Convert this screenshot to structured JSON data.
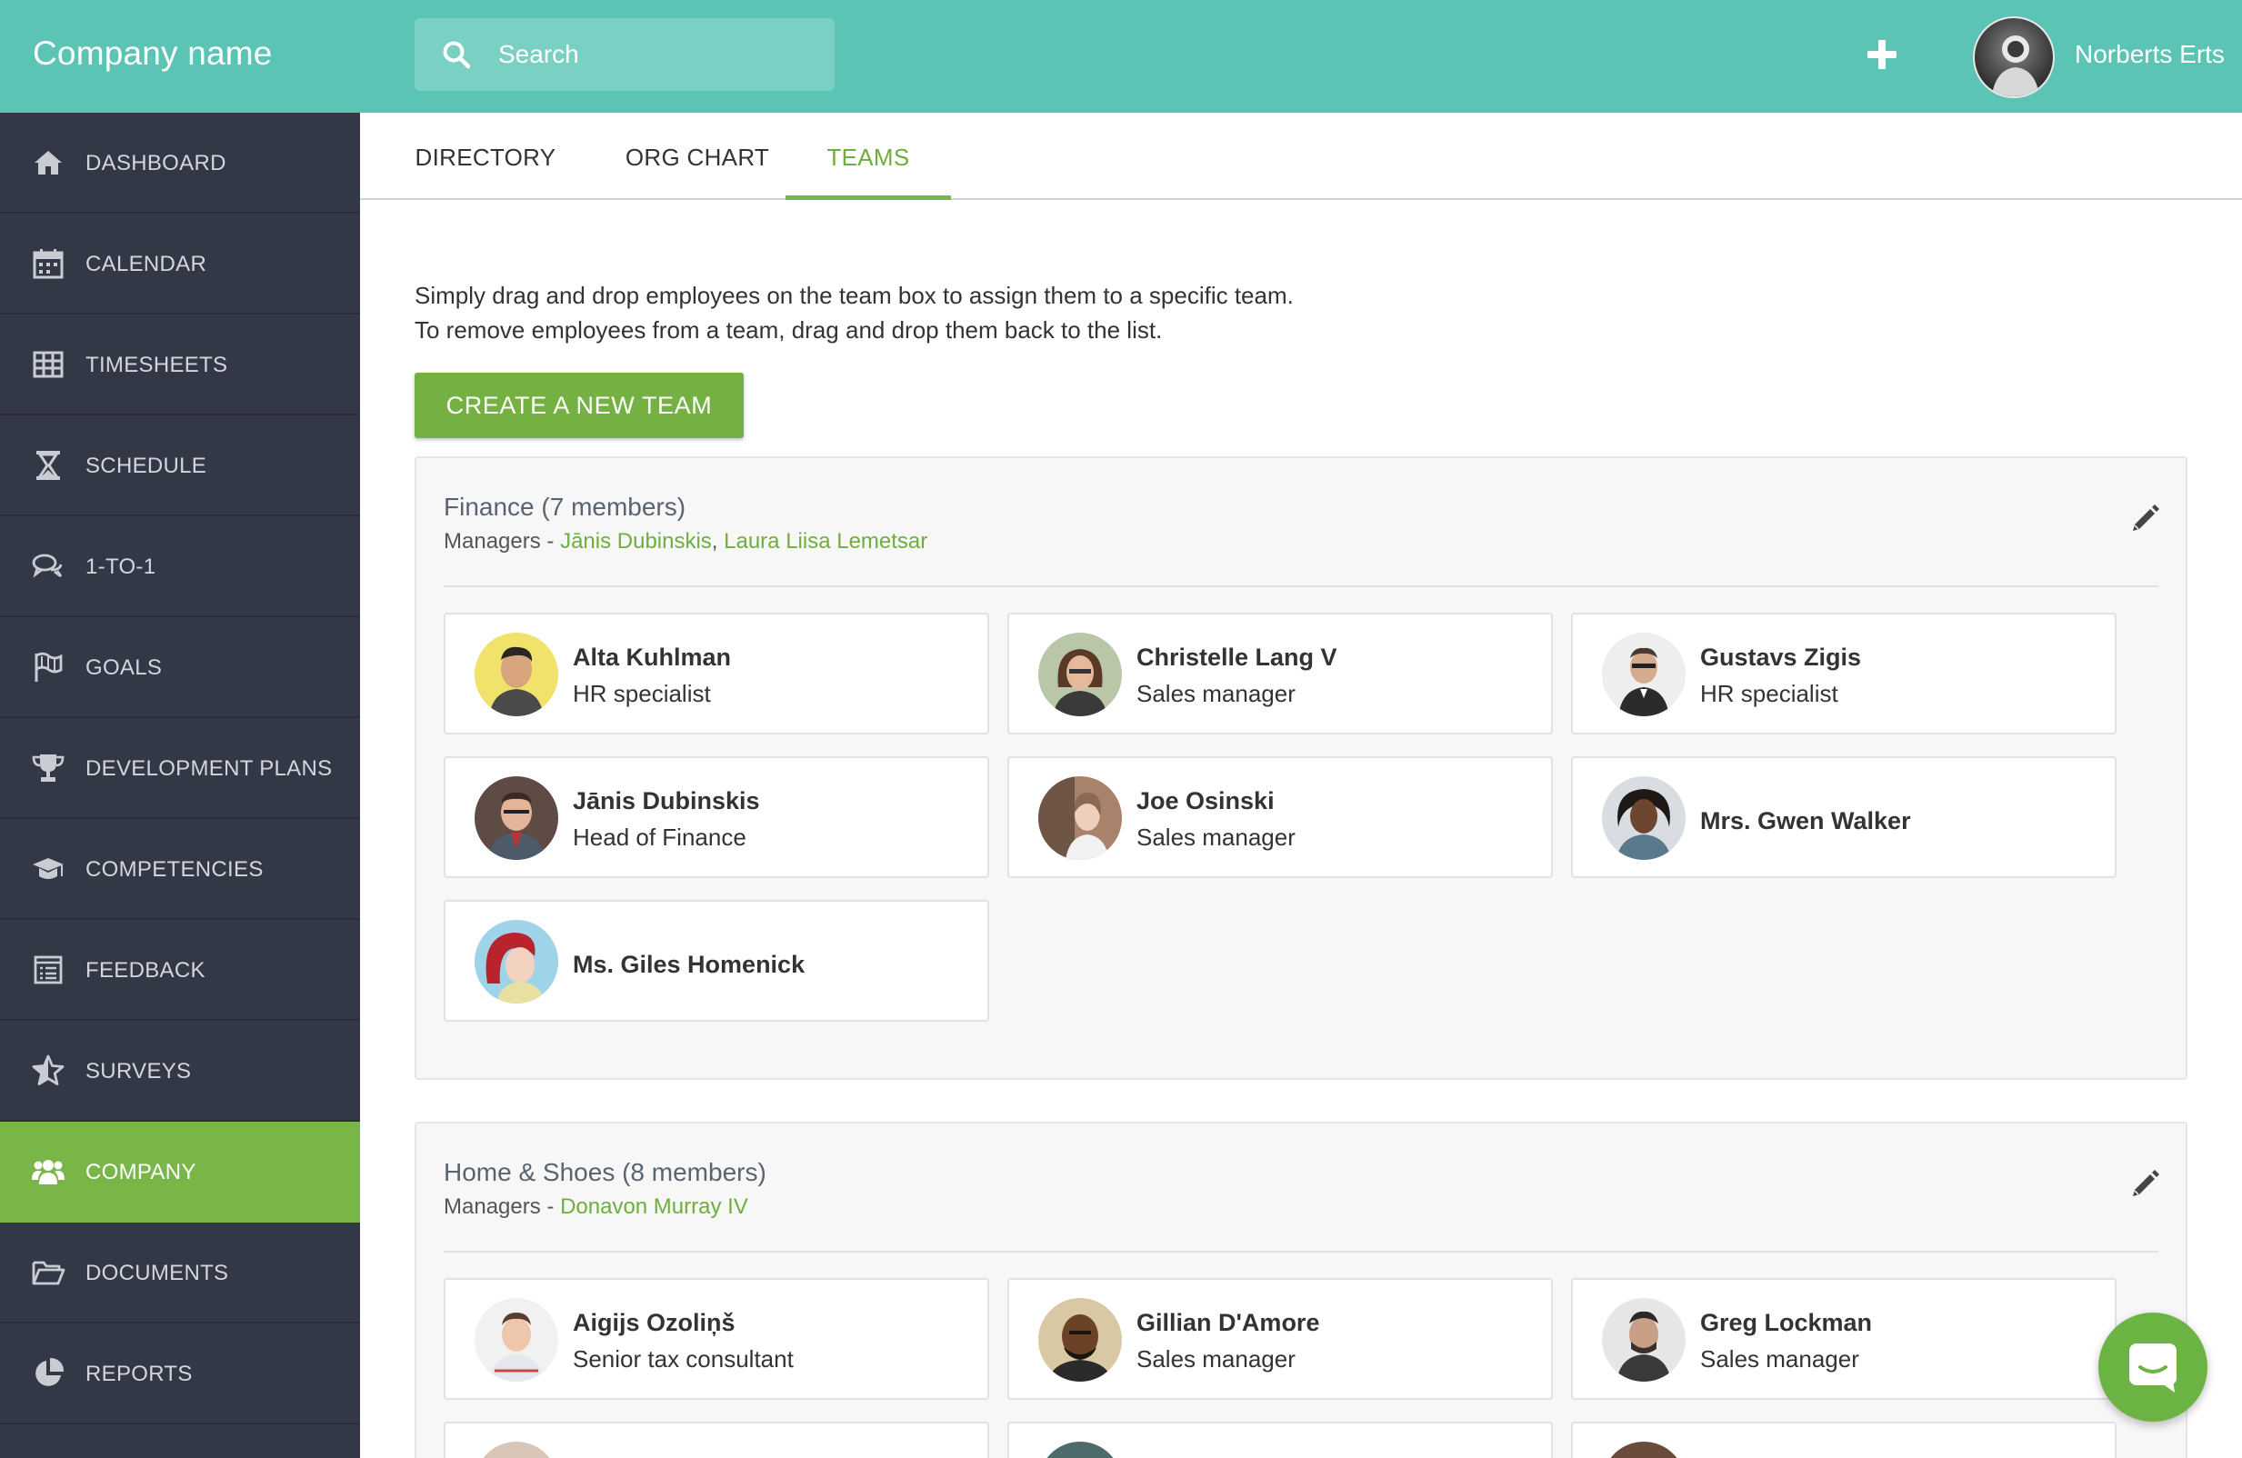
{
  "header": {
    "brand": "Company name",
    "search_placeholder": "Search",
    "user_name": "Norberts Erts"
  },
  "sidebar": {
    "items": [
      {
        "label": "DASHBOARD",
        "icon": "home-icon"
      },
      {
        "label": "CALENDAR",
        "icon": "calendar-icon"
      },
      {
        "label": "TIMESHEETS",
        "icon": "table-icon"
      },
      {
        "label": "SCHEDULE",
        "icon": "hourglass-icon"
      },
      {
        "label": "1-TO-1",
        "icon": "chat-bubbles-icon"
      },
      {
        "label": "GOALS",
        "icon": "flag-icon"
      },
      {
        "label": "DEVELOPMENT PLANS",
        "icon": "trophy-icon"
      },
      {
        "label": "COMPETENCIES",
        "icon": "graduation-cap-icon"
      },
      {
        "label": "FEEDBACK",
        "icon": "feedback-list-icon"
      },
      {
        "label": "SURVEYS",
        "icon": "star-icon"
      },
      {
        "label": "COMPANY",
        "icon": "users-icon",
        "active": true
      },
      {
        "label": "DOCUMENTS",
        "icon": "folder-icon"
      },
      {
        "label": "REPORTS",
        "icon": "pie-chart-icon"
      }
    ]
  },
  "tabs": [
    {
      "label": "DIRECTORY"
    },
    {
      "label": "ORG CHART"
    },
    {
      "label": "TEAMS",
      "active": true
    }
  ],
  "intro": {
    "line1": "Simply drag and drop employees on the team box to assign them to a specific team.",
    "line2": "To remove employees from a team, drag and drop them back to the list."
  },
  "create_button": "CREATE A NEW TEAM",
  "teams": [
    {
      "title": "Finance (7 members)",
      "managers_prefix": "Managers - ",
      "managers": [
        "Jānis Dubinskis",
        "Laura Liisa Lemetsar"
      ],
      "members": [
        {
          "name": "Alta Kuhlman",
          "role": "HR specialist"
        },
        {
          "name": "Christelle Lang V",
          "role": "Sales manager"
        },
        {
          "name": "Gustavs Zigis",
          "role": "HR specialist"
        },
        {
          "name": "Jānis Dubinskis",
          "role": "Head of Finance"
        },
        {
          "name": "Joe Osinski",
          "role": "Sales manager"
        },
        {
          "name": "Mrs. Gwen Walker",
          "role": ""
        },
        {
          "name": "Ms. Giles Homenick",
          "role": ""
        }
      ]
    },
    {
      "title": "Home & Shoes (8 members)",
      "managers_prefix": "Managers - ",
      "managers": [
        "Donavon Murray IV"
      ],
      "members": [
        {
          "name": "Aigijs Ozoliņš",
          "role": "Senior tax consultant"
        },
        {
          "name": "Gillian D'Amore",
          "role": "Sales manager"
        },
        {
          "name": "Greg Lockman",
          "role": "Sales manager"
        }
      ]
    }
  ],
  "colors": {
    "header": "#5bc4b4",
    "sidebar": "#333847",
    "accent": "#7ab547"
  }
}
